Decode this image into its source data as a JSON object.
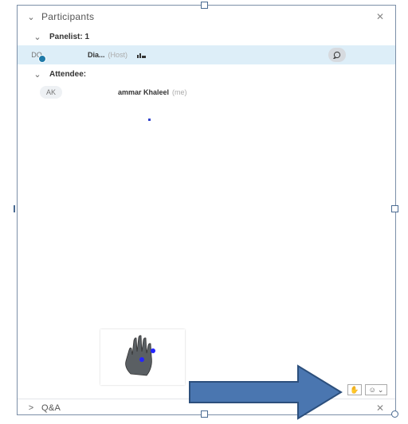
{
  "participants": {
    "title": "Participants",
    "close_icon": "close-icon"
  },
  "panelists": {
    "label": "Panelist: 1",
    "items": [
      {
        "initials": "DO",
        "name": "Dia...",
        "role": "(Host)"
      }
    ]
  },
  "attendees": {
    "label": "Attendee:",
    "items": [
      {
        "initials": "AK",
        "name": "ammar Khaleel",
        "role": "(me)"
      }
    ]
  },
  "qa": {
    "title": "Q&A"
  },
  "colors": {
    "selected_row": "#ddeef8",
    "arrow_fill": "#4a76b0",
    "arrow_stroke": "#2c4f7c",
    "border": "#7c8fa8"
  }
}
